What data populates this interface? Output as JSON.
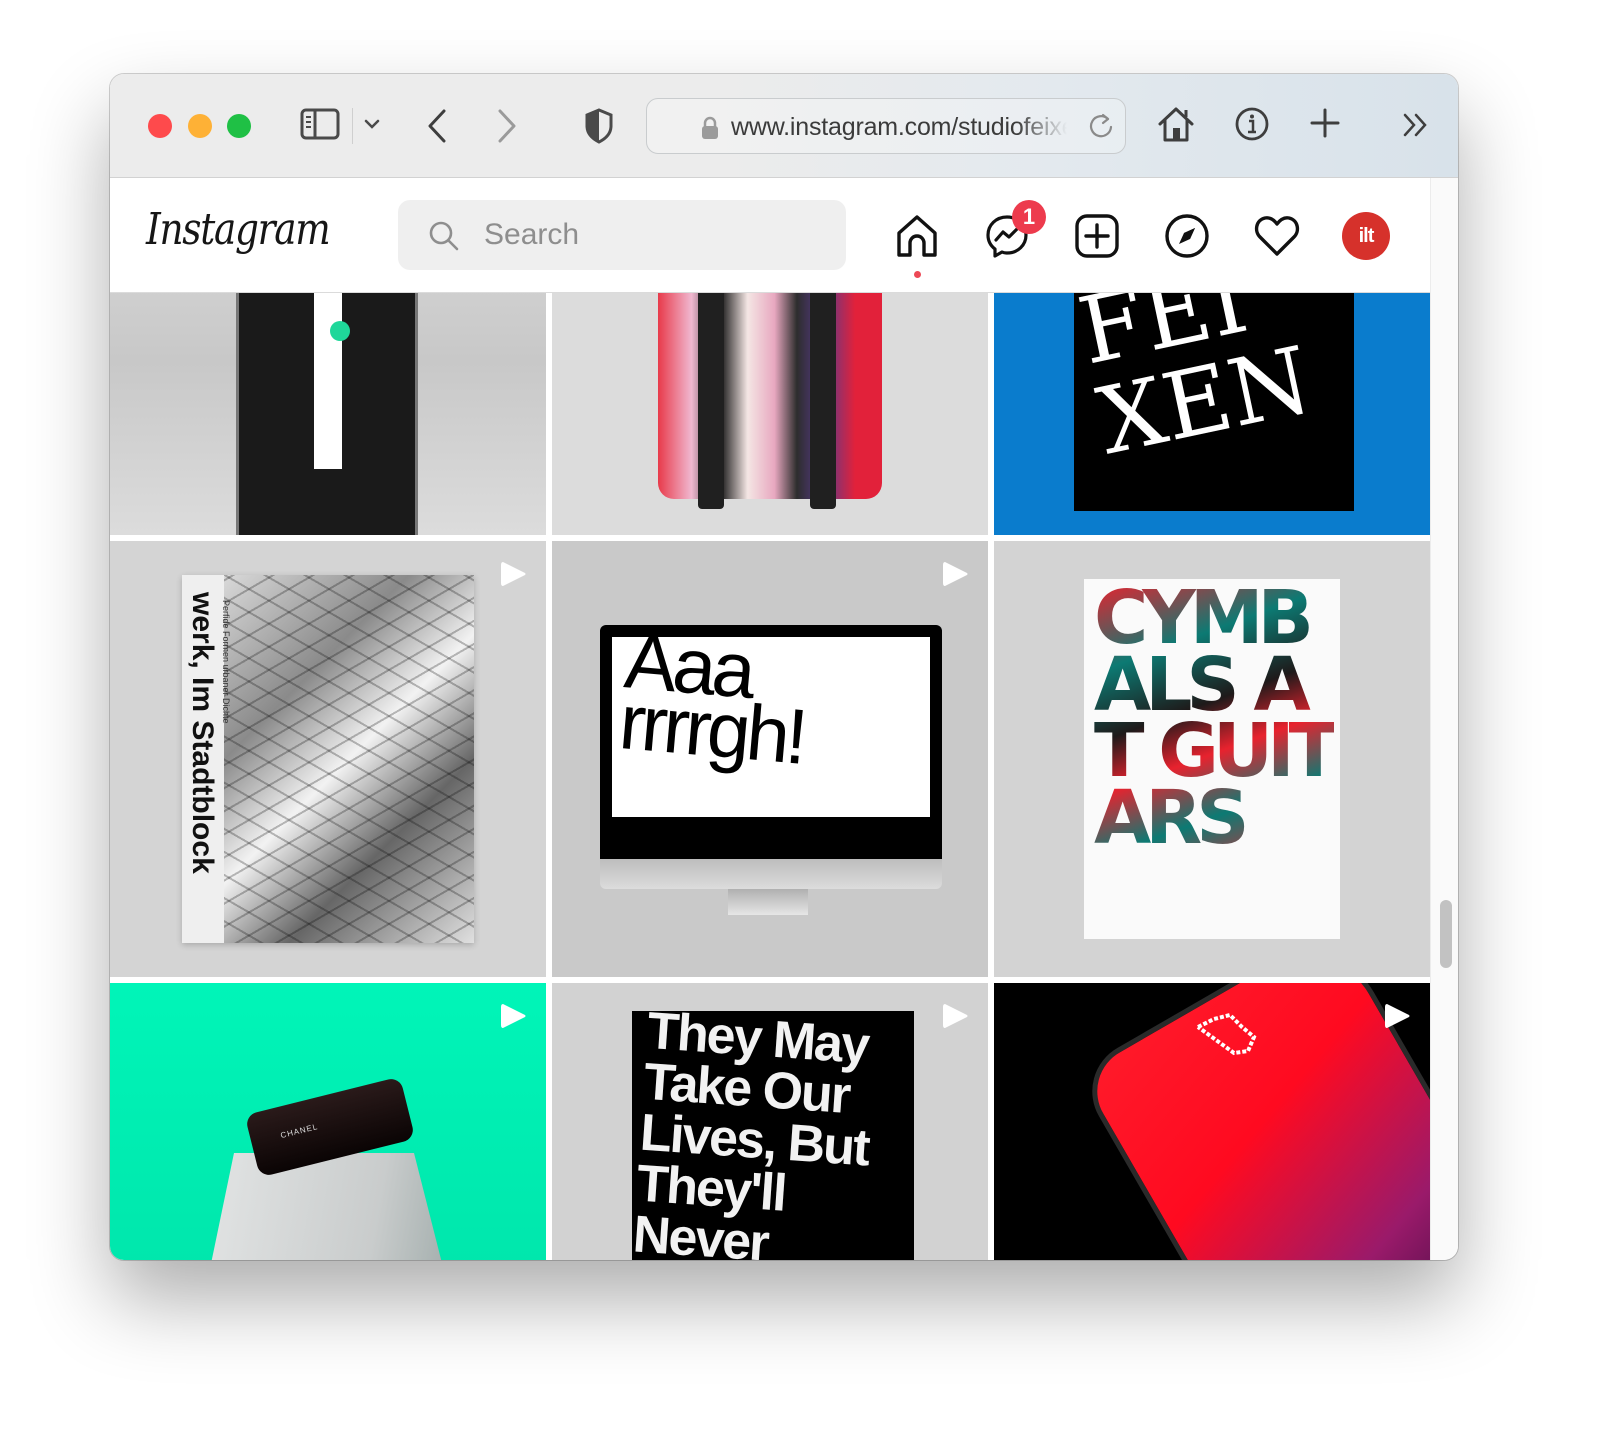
{
  "browser": {
    "url": "www.instagram.com/studiofeixen",
    "icons": {
      "sidebar": "sidebar-icon",
      "dropdown": "chevron-down-icon",
      "back": "chevron-left-icon",
      "forward": "chevron-right-icon",
      "privacy": "shield-icon",
      "lock": "lock-icon",
      "reload": "reload-icon",
      "home": "home-icon",
      "info": "info-icon",
      "new_tab": "plus-icon",
      "more": "double-chevron-icon"
    }
  },
  "instagram": {
    "logo": "Instagram",
    "search": {
      "placeholder": "Search"
    },
    "nav": {
      "home": "home-icon",
      "messenger": "messenger-icon",
      "messenger_badge": "1",
      "new_post": "plus-square-icon",
      "explore": "compass-icon",
      "activity": "heart-icon",
      "profile_avatar_text": "ilt"
    },
    "colors": {
      "badge": "#ed3b4d",
      "avatar": "#d6312b",
      "active_dot": "#ed4956"
    },
    "posts": [
      {
        "description": "Phone mockup with vertical white bar and green dot",
        "is_video": false
      },
      {
        "description": "Colorful patterned backpack from behind",
        "is_video": false
      },
      {
        "description": "Feixen typography poster on blue",
        "text": "FEI XEN",
        "is_video": false
      },
      {
        "description": "werk magazine cover, isometric city blocks",
        "text": "werk, Im Stadtblock",
        "subtitle": "Perfide Formen urbaner Dichte",
        "is_video": true
      },
      {
        "description": "iMac with typography animation",
        "text": "Aaa rrrrgh!",
        "is_video": true
      },
      {
        "description": "Cymbals at Guitars typography poster",
        "text": "CYMBALS AT GUITARS",
        "is_video": true
      },
      {
        "description": "Chanel lipstick on marble plinth, mint background",
        "text": "CHANEL",
        "is_video": true
      },
      {
        "description": "Hanging black typography poster",
        "text": "They May Take Our Lives, But They'll Never",
        "is_video": true
      },
      {
        "description": "Red gradient phone with pixel cursor",
        "is_video": true
      }
    ]
  }
}
